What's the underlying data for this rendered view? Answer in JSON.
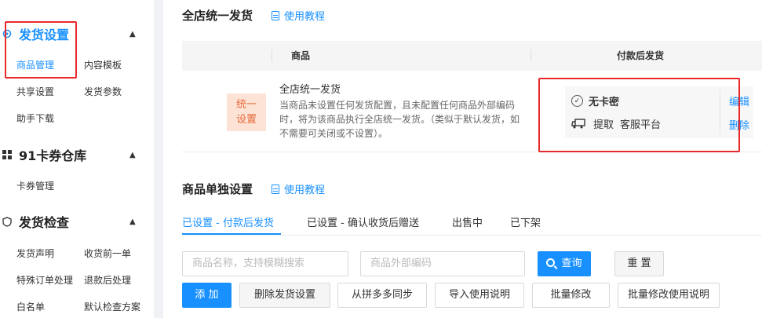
{
  "sidebar": {
    "sections": [
      {
        "title": "发货设置",
        "items": [
          "商品管理",
          "内容模板",
          "共享设置",
          "发货参数",
          "助手下载"
        ]
      },
      {
        "title": "91卡券仓库",
        "items": [
          "卡券管理"
        ]
      },
      {
        "title": "发货检查",
        "items": [
          "发货声明",
          "收货前一单",
          "特殊订单处理",
          "退款后处理",
          "白名单",
          "默认检查方案"
        ]
      }
    ]
  },
  "global": {
    "title": "全店统一发货",
    "help": "使用教程",
    "columns": {
      "product": "商品",
      "after_pay": "付款后发货"
    },
    "row": {
      "tag_line1": "统一",
      "tag_line2": "设置",
      "title": "全店统一发货",
      "desc": "当商品未设置任何发货配置，且未配置任何商品外部编码时，将为该商品执行全店统一发货。（类似于默认发货，如不需要可关闭或不设置）。",
      "config_line1": "无卡密",
      "config_pickup": "提取",
      "config_platform": "客服平台",
      "edit": "编辑",
      "delete": "删除"
    }
  },
  "single": {
    "title": "商品单独设置",
    "help": "使用教程",
    "tabs": [
      "已设置 - 付款后发货",
      "已设置 - 确认收货后赠送",
      "出售中",
      "已下架"
    ],
    "search_name_placeholder": "商品名称，支持模糊搜索",
    "search_code_placeholder": "商品外部编码",
    "query": "查询",
    "reset": "重 置",
    "actions": [
      "添 加",
      "删除发货设置",
      "从拼多多同步",
      "导入使用说明",
      "批量修改",
      "批量修改使用说明"
    ]
  },
  "colors": {
    "accent": "#1890ff",
    "highlight_box": "#e8292c",
    "tag_bg": "#fde3d6",
    "tag_text": "#e86a3a"
  }
}
